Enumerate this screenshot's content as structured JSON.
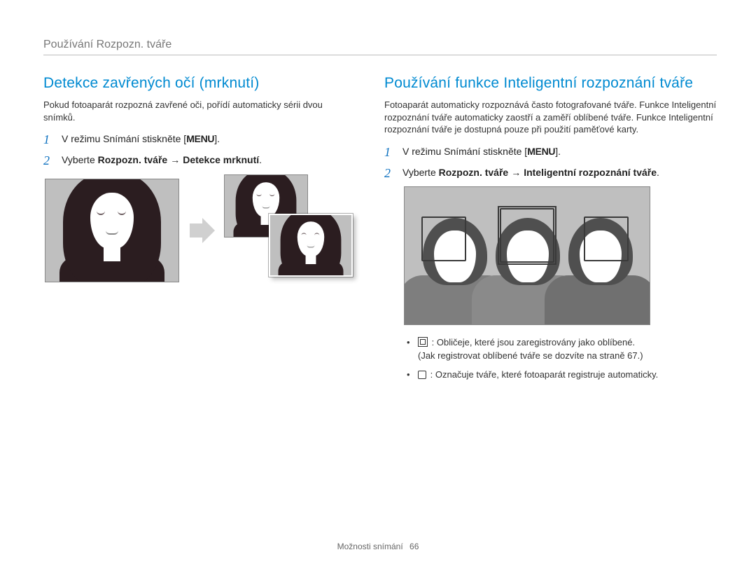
{
  "section_header": "Používání Rozpozn. tváře",
  "left": {
    "title": "Detekce zavřených očí (mrknutí)",
    "body": "Pokud fotoaparát rozpozná zavřené oči, pořídí automaticky sérii dvou snímků.",
    "step1_pre": "V režimu Snímání stiskněte [",
    "step1_menu": "MENU",
    "step1_post": "].",
    "step2_pre": "Vyberte ",
    "step2_bold1": "Rozpozn. tváře",
    "step2_bold2": "Detekce mrknutí",
    "step2_post": "."
  },
  "right": {
    "title": "Používání funkce Inteligentní rozpoznání tváře",
    "body": "Fotoaparát automaticky rozpoznává často fotografované tváře. Funkce Inteligentní rozpoznání tváře automaticky zaostří a zaměří oblíbené tváře. Funkce Inteligentní rozpoznání tváře je dostupná pouze při použití paměťové karty.",
    "step1_pre": "V režimu Snímání stiskněte [",
    "step1_menu": "MENU",
    "step1_post": "].",
    "step2_pre": "Vyberte ",
    "step2_bold1": "Rozpozn. tváře",
    "step2_bold2": "Inteligentní rozpoznání tváře",
    "step2_post": ".",
    "legend1_a": ": Obličeje, které jsou zaregistrovány jako oblíbené.",
    "legend1_b": "(Jak registrovat oblíbené tváře se dozvíte na straně 67.)",
    "legend2": ": Označuje tváře, které fotoaparát registruje automaticky."
  },
  "arrow_glyph": "→",
  "footer_label": "Možnosti snímání",
  "footer_page": "66"
}
